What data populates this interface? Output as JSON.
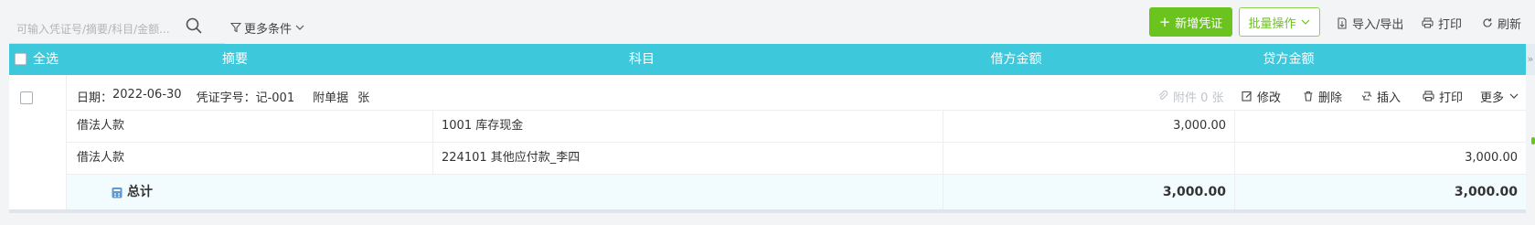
{
  "toolbar": {
    "search_placeholder": "可输入凭证号/摘要/科目/金额...",
    "more_conditions": "更多条件",
    "add_voucher": "新增凭证",
    "batch_ops": "批量操作",
    "import_export": "导入/导出",
    "print": "打印",
    "refresh": "刷新",
    "accent_color": "#6bc41d"
  },
  "table": {
    "header_color": "#3ec8dc",
    "select_all": "全选",
    "columns": [
      "摘要",
      "科目",
      "借方金额",
      "贷方金额"
    ],
    "collapse_glyph": "»"
  },
  "voucher": {
    "date_label": "日期：",
    "date": "2022-06-30",
    "number_label": "凭证字号：",
    "number": "记-001",
    "attach_label": "附单据",
    "attach_unit": "张",
    "attachments_text": "附件 0 张",
    "actions": {
      "edit": "修改",
      "delete": "删除",
      "insert": "插入",
      "print": "打印",
      "more": "更多"
    },
    "entries": [
      {
        "summary": "借法人款",
        "account": "1001 库存现金",
        "debit": "3,000.00",
        "credit": ""
      },
      {
        "summary": "借法人款",
        "account": "224101 其他应付款_李四",
        "debit": "",
        "credit": "3,000.00"
      }
    ],
    "total": {
      "label": "总计",
      "debit": "3,000.00",
      "credit": "3,000.00"
    }
  }
}
